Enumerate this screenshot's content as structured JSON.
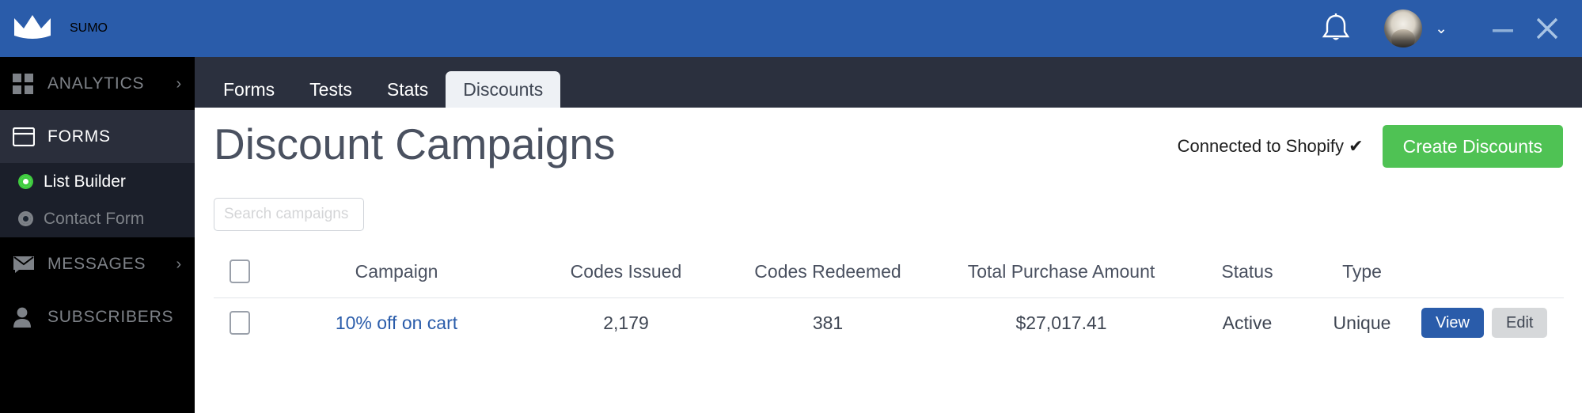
{
  "topbar": {
    "brand_name": "SUMO",
    "crown_icon": "crown-icon",
    "bell_icon": "bell-icon",
    "avatar_caret": "⌄",
    "minimize_label": "_",
    "close_label": "✕"
  },
  "sidebar": {
    "items": [
      {
        "label": "ANALYTICS",
        "icon": "grid-icon",
        "active": false,
        "chevron": "›"
      },
      {
        "label": "FORMS",
        "icon": "window-icon",
        "active": true,
        "chevron": ""
      },
      {
        "label": "MESSAGES",
        "icon": "envelope-icon",
        "active": false,
        "chevron": "›"
      },
      {
        "label": "SUBSCRIBERS",
        "icon": "person-icon",
        "active": false,
        "chevron": ""
      }
    ],
    "submenu": [
      {
        "label": "List Builder",
        "active": true
      },
      {
        "label": "Contact Form",
        "active": false
      }
    ]
  },
  "main": {
    "tabs": [
      {
        "label": "Forms",
        "active": false
      },
      {
        "label": "Tests",
        "active": false
      },
      {
        "label": "Stats",
        "active": false
      },
      {
        "label": "Discounts",
        "active": true
      }
    ],
    "page_title": "Discount Campaigns",
    "connected_status": "Connected to Shopify ✔",
    "create_button": "Create Discounts",
    "search_placeholder": "Search campaigns",
    "search_value": "",
    "table": {
      "headers": {
        "campaign": "Campaign",
        "codes_issued": "Codes Issued",
        "codes_redeemed": "Codes Redeemed",
        "total_purchase_amount": "Total Purchase Amount",
        "status": "Status",
        "type": "Type"
      },
      "rows": [
        {
          "campaign": "10% off on cart",
          "codes_issued": "2,179",
          "codes_redeemed": "381",
          "total_purchase_amount": "$27,017.41",
          "status": "Active",
          "type": "Unique",
          "view_label": "View",
          "edit_label": "Edit"
        }
      ]
    }
  },
  "colors": {
    "brand_blue": "#2a5caa",
    "sidebar_black": "#000000",
    "sidebar_active": "#2a2e3b",
    "panel_dark": "#2b303e",
    "accent_green": "#4fc254",
    "link_blue": "#2a5caa"
  }
}
